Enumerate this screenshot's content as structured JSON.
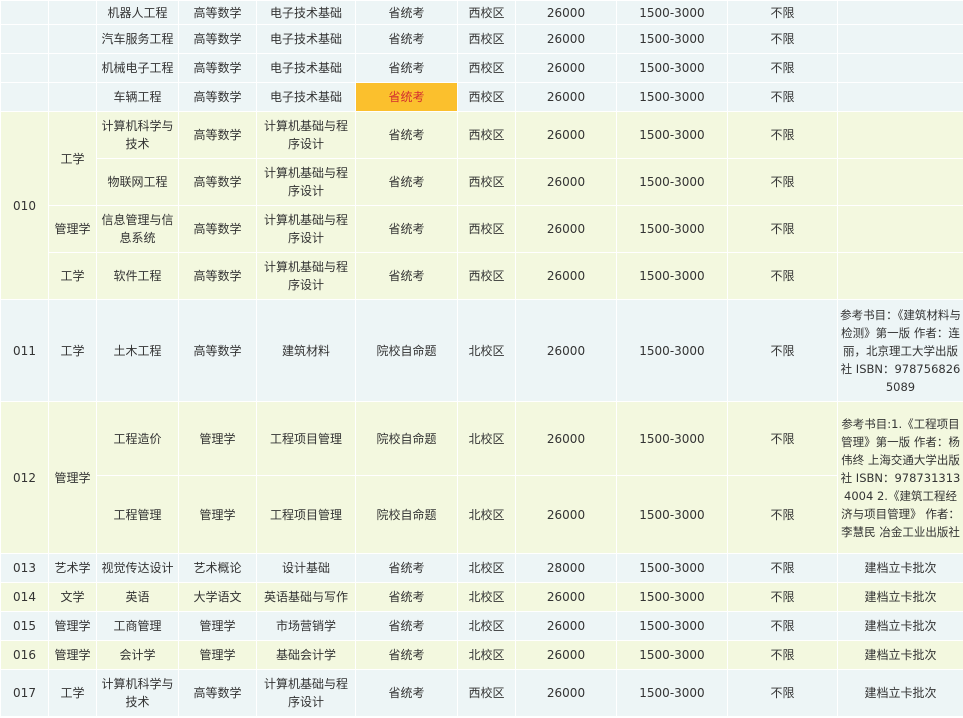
{
  "rows": {
    "r1": {
      "major": "机器人工程",
      "exam1": "高等数学",
      "exam2": "电子技术基础",
      "type": "省统考",
      "campus": "西校区",
      "fee": "26000",
      "range": "1500-3000",
      "limit": "不限"
    },
    "r2": {
      "major": "汽车服务工程",
      "exam1": "高等数学",
      "exam2": "电子技术基础",
      "type": "省统考",
      "campus": "西校区",
      "fee": "26000",
      "range": "1500-3000",
      "limit": "不限"
    },
    "r3": {
      "major": "机械电子工程",
      "exam1": "高等数学",
      "exam2": "电子技术基础",
      "type": "省统考",
      "campus": "西校区",
      "fee": "26000",
      "range": "1500-3000",
      "limit": "不限"
    },
    "r4": {
      "major": "车辆工程",
      "exam1": "高等数学",
      "exam2": "电子技术基础",
      "type": "省统考",
      "campus": "西校区",
      "fee": "26000",
      "range": "1500-3000",
      "limit": "不限"
    },
    "r5": {
      "code": "010",
      "cat": "工学",
      "major": "计算机科学与技术",
      "exam1": "高等数学",
      "exam2": "计算机基础与程序设计",
      "type": "省统考",
      "campus": "西校区",
      "fee": "26000",
      "range": "1500-3000",
      "limit": "不限"
    },
    "r6": {
      "major": "物联网工程",
      "exam1": "高等数学",
      "exam2": "计算机基础与程序设计",
      "type": "省统考",
      "campus": "西校区",
      "fee": "26000",
      "range": "1500-3000",
      "limit": "不限"
    },
    "r7": {
      "cat": "管理学",
      "major": "信息管理与信息系统",
      "exam1": "高等数学",
      "exam2": "计算机基础与程序设计",
      "type": "省统考",
      "campus": "西校区",
      "fee": "26000",
      "range": "1500-3000",
      "limit": "不限"
    },
    "r8": {
      "cat": "工学",
      "major": "软件工程",
      "exam1": "高等数学",
      "exam2": "计算机基础与程序设计",
      "type": "省统考",
      "campus": "西校区",
      "fee": "26000",
      "range": "1500-3000",
      "limit": "不限"
    },
    "r9": {
      "code": "011",
      "cat": "工学",
      "major": "土木工程",
      "exam1": "高等数学",
      "exam2": "建筑材料",
      "type": "院校自命题",
      "campus": "北校区",
      "fee": "26000",
      "range": "1500-3000",
      "limit": "不限",
      "note": "参考书目：《建筑材料与检测》第一版 作者：连丽，北京理工大学出版社 ISBN：9787568265089"
    },
    "r10": {
      "code": "012",
      "cat": "管理学",
      "major": "工程造价",
      "exam1": "管理学",
      "exam2": "工程项目管理",
      "type": "院校自命题",
      "campus": "北校区",
      "fee": "26000",
      "range": "1500-3000",
      "limit": "不限",
      "note": "参考书目:1.《工程项目管理》第一版 作者：杨伟终 上海交通大学出版社 ISBN：9787313134004 2.《建筑工程经济与项目管理》 作者：李慧民 冶金工业出版社"
    },
    "r11": {
      "major": "工程管理",
      "exam1": "管理学",
      "exam2": "工程项目管理",
      "type": "院校自命题",
      "campus": "北校区",
      "fee": "26000",
      "range": "1500-3000",
      "limit": "不限"
    },
    "r12": {
      "code": "013",
      "cat": "艺术学",
      "major": "视觉传达设计",
      "exam1": "艺术概论",
      "exam2": "设计基础",
      "type": "省统考",
      "campus": "北校区",
      "fee": "28000",
      "range": "1500-3000",
      "limit": "不限",
      "note": "建档立卡批次"
    },
    "r13": {
      "code": "014",
      "cat": "文学",
      "major": "英语",
      "exam1": "大学语文",
      "exam2": "英语基础与写作",
      "type": "省统考",
      "campus": "北校区",
      "fee": "26000",
      "range": "1500-3000",
      "limit": "不限",
      "note": "建档立卡批次"
    },
    "r14": {
      "code": "015",
      "cat": "管理学",
      "major": "工商管理",
      "exam1": "管理学",
      "exam2": "市场营销学",
      "type": "省统考",
      "campus": "北校区",
      "fee": "26000",
      "range": "1500-3000",
      "limit": "不限",
      "note": "建档立卡批次"
    },
    "r15": {
      "code": "016",
      "cat": "管理学",
      "major": "会计学",
      "exam1": "管理学",
      "exam2": "基础会计学",
      "type": "省统考",
      "campus": "北校区",
      "fee": "26000",
      "range": "1500-3000",
      "limit": "不限",
      "note": "建档立卡批次"
    },
    "r16": {
      "code": "017",
      "cat": "工学",
      "major": "计算机科学与技术",
      "exam1": "高等数学",
      "exam2": "计算机基础与程序设计",
      "type": "省统考",
      "campus": "西校区",
      "fee": "26000",
      "range": "1500-3000",
      "limit": "不限",
      "note": "建档立卡批次"
    }
  }
}
